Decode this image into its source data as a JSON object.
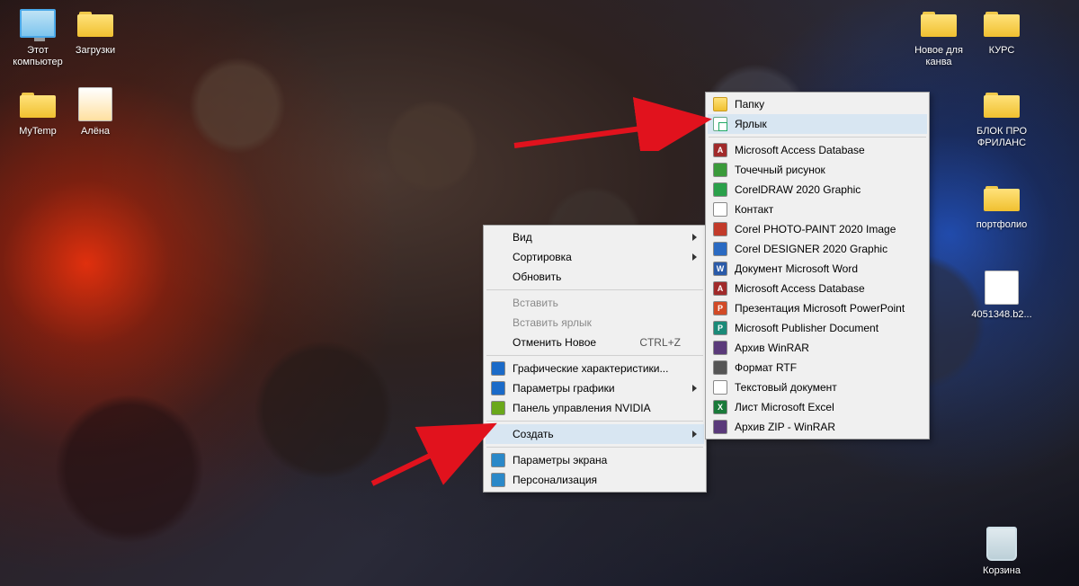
{
  "desktop_icons": {
    "this_pc": "Этот компьютер",
    "downloads": "Загрузки",
    "mytemp": "MyTemp",
    "alena": "Алёна",
    "new_for_canva": "Новое для канва",
    "kurs": "КУРС",
    "blok_freelance": "БЛОК ПРО ФРИЛАНС",
    "portfolio": "портфолио",
    "file_b2": "4051348.b2...",
    "recycle": "Корзина"
  },
  "ctx": {
    "vid": "Вид",
    "sort": "Сортировка",
    "refresh": "Обновить",
    "paste": "Вставить",
    "paste_short": "Вставить ярлык",
    "undo": "Отменить Новое",
    "undo_sc": "CTRL+Z",
    "gfx_props": "Графические характеристики...",
    "gfx_params": "Параметры графики",
    "nvidia": "Панель управления NVIDIA",
    "create": "Создать",
    "display": "Параметры экрана",
    "person": "Персонализация"
  },
  "sub": {
    "folder": "Папку",
    "shortcut": "Ярлык",
    "access": "Microsoft Access Database",
    "bmp": "Точечный рисунок",
    "corel": "CorelDRAW 2020 Graphic",
    "contact": "Контакт",
    "photopaint": "Corel PHOTO-PAINT 2020 Image",
    "designer": "Corel DESIGNER 2020 Graphic",
    "word": "Документ Microsoft Word",
    "access2": "Microsoft Access Database",
    "ppt": "Презентация Microsoft PowerPoint",
    "publisher": "Microsoft Publisher Document",
    "rar": "Архив WinRAR",
    "rtf": "Формат RTF",
    "txt": "Текстовый документ",
    "excel": "Лист Microsoft Excel",
    "zip": "Архив ZIP - WinRAR"
  }
}
